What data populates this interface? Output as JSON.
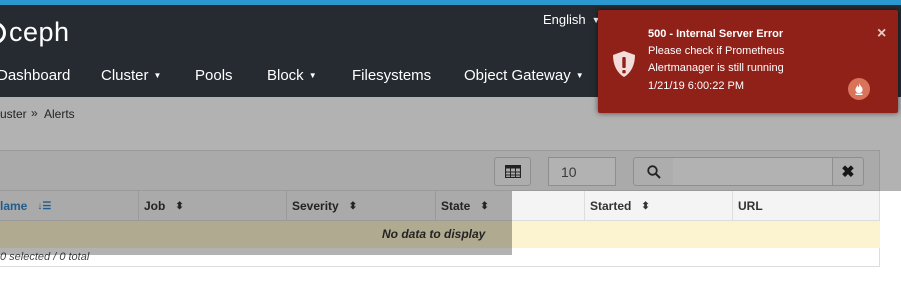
{
  "header": {
    "logo_text": "ceph",
    "language": "English"
  },
  "nav": {
    "items": [
      {
        "label": "Dashboard",
        "dropdown": false
      },
      {
        "label": "Cluster",
        "dropdown": true
      },
      {
        "label": "Pools",
        "dropdown": false
      },
      {
        "label": "Block",
        "dropdown": true
      },
      {
        "label": "Filesystems",
        "dropdown": false
      },
      {
        "label": "Object Gateway",
        "dropdown": true
      }
    ]
  },
  "breadcrumb": {
    "parent": "uster",
    "current": "Alerts",
    "separator": "»"
  },
  "toolbar": {
    "page_size": "10",
    "search_value": ""
  },
  "table": {
    "columns": [
      {
        "label": "Name",
        "shown": "lame",
        "sort": "asc-active"
      },
      {
        "label": "Job",
        "sort": "both"
      },
      {
        "label": "Severity",
        "sort": "both"
      },
      {
        "label": "State",
        "sort": "both"
      },
      {
        "label": "",
        "sort": "none"
      },
      {
        "label": "Started",
        "sort": "both"
      },
      {
        "label": "URL",
        "sort": "none"
      }
    ],
    "empty_message": "No data to display",
    "footer": "0 selected / 0 total"
  },
  "toast": {
    "title": "500 - Internal Server Error",
    "message_line1": "Please check if Prometheus",
    "message_line2": "Alertmanager is still running",
    "timestamp": "1/21/19 6:00:22 PM",
    "close_symbol": "×",
    "icon": "shield-exclamation-icon",
    "badge_icon": "prometheus-flame-icon"
  },
  "colors": {
    "accent": "#2b99d0",
    "header_bg": "#252b31",
    "toast_bg": "#8f2119",
    "link": "#2b86c9",
    "empty_row": "#fcf4d0"
  }
}
